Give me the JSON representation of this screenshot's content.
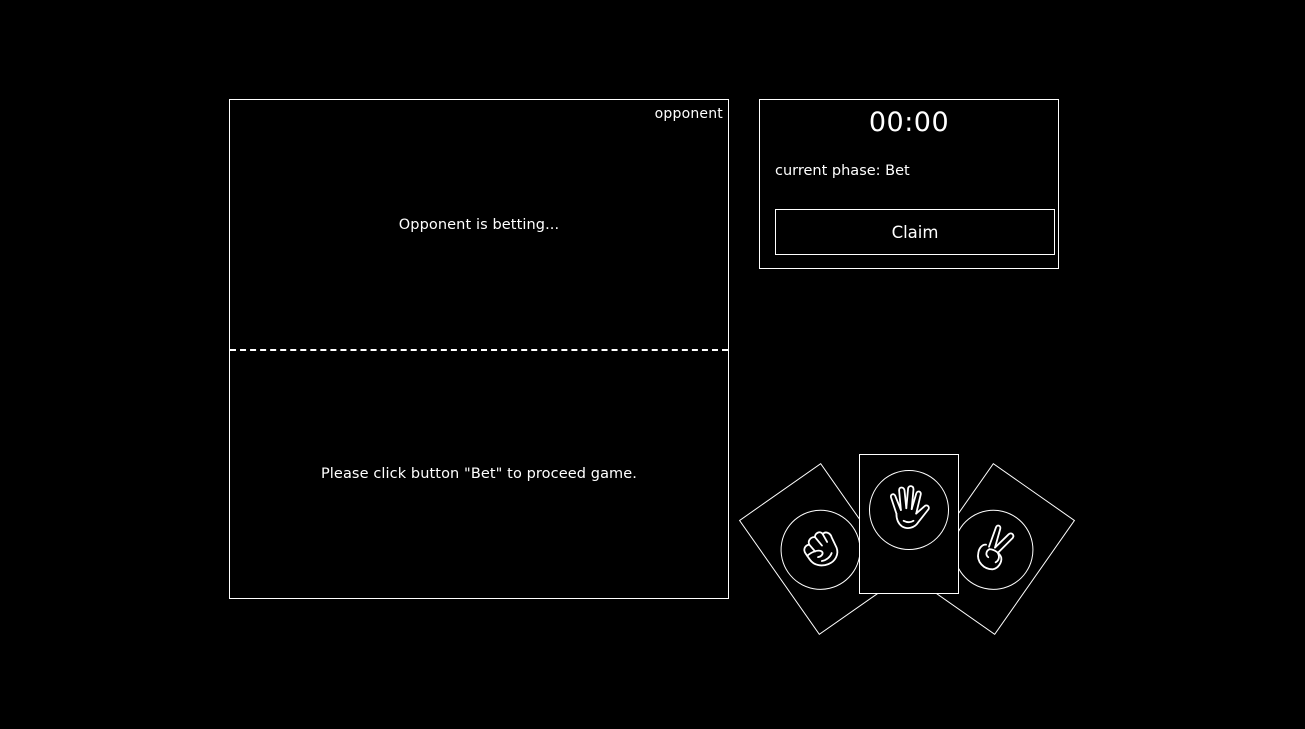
{
  "board": {
    "opponent_label": "opponent",
    "opponent_message": "Opponent is betting...",
    "player_message": "Please click button \"Bet\" to proceed game."
  },
  "status": {
    "timer": "00:00",
    "phase": "current phase: Bet",
    "claim_label": "Claim"
  },
  "hand": {
    "cards": [
      {
        "name": "rock",
        "icon": "fist-icon"
      },
      {
        "name": "paper",
        "icon": "open-hand-icon"
      },
      {
        "name": "scissors",
        "icon": "peace-hand-icon"
      }
    ]
  },
  "colors": {
    "background": "#000000",
    "foreground": "#ffffff"
  }
}
